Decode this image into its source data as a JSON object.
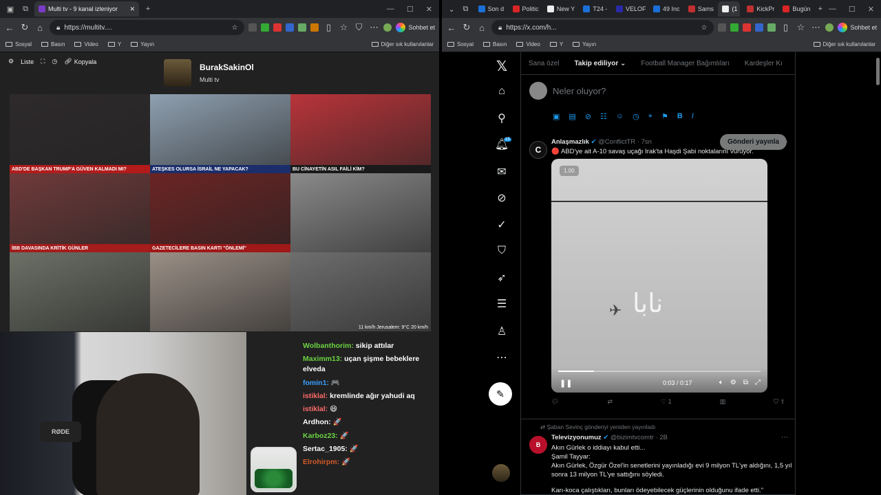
{
  "left_browser": {
    "tabs": [
      {
        "title": "Multi tv - 9 kanal izleniyor",
        "color": "#7a3cc8"
      }
    ],
    "url": "https://multitv....",
    "chat_label": "Sohbet et",
    "bookmarks": [
      "Sosyal",
      "Basın",
      "Video",
      "Y",
      "Yayın"
    ],
    "other_bookmarks": "Diğer sık kullanılanlar"
  },
  "multitv": {
    "controls": [
      "Liste",
      "Kopyala"
    ],
    "channel_name": "BurakSakinOl",
    "channel_sub": "Multi tv",
    "cells": [
      {
        "caption": "ABD'DE BAŞKAN TRUMP'A GÜVEN KALMADI MI?",
        "bg": "#2e2a2c",
        "cap": "#b31b1b"
      },
      {
        "caption": "ATEŞKES OLURSA İSRAİL NE YAPACAK?",
        "bg": "#8fa0b0",
        "cap": "#1b2e6b"
      },
      {
        "caption": "BU CİNAYETİN ASIL FAİLİ KİM?",
        "bg": "#b8343a",
        "cap": "#1a1a1a"
      },
      {
        "caption": "İBB DAVASINDA KRİTİK GÜNLER",
        "bg": "#6f3a3a",
        "cap": "#a51c1c"
      },
      {
        "caption": "GAZETECİLERE BASIN KARTI \"ÖNLEMİ\"",
        "bg": "#6b2424",
        "cap": "#a01818"
      },
      {
        "caption": "",
        "bg": "#8a8a8a",
        "cap": "transparent"
      },
      {
        "caption": "",
        "bg": "#6c7066",
        "cap": "transparent"
      },
      {
        "caption": "",
        "bg": "#9a8f86",
        "cap": "transparent"
      },
      {
        "caption": "11 km/h  Jerusalem: 9°C  20 km/h",
        "bg": "#6e6e6e",
        "cap": "transparent"
      }
    ]
  },
  "chat": [
    {
      "user": "Wolbanthorim:",
      "text": " sikip attılar",
      "color": "#6cd442"
    },
    {
      "user": "Maximm13:",
      "text": " uçan şişme bebeklere elveda",
      "color": "#6cd442"
    },
    {
      "user": "fomin1:",
      "text": " 🎮",
      "color": "#3aa0ff"
    },
    {
      "user": "istiklal:",
      "text": " kremlinde ağır yahudi aq",
      "color": "#ff6a6a"
    },
    {
      "user": "istiklal:",
      "text": " 😄",
      "color": "#ff6a6a"
    },
    {
      "user": "Ardhon:",
      "text": " 🚀",
      "color": "#ffffff"
    },
    {
      "user": "Karboz23:",
      "text": " 🚀",
      "color": "#6cd442"
    },
    {
      "user": "Sertac_1905:",
      "text": " 🚀",
      "color": "#ffffff"
    },
    {
      "user": "Elrohirpm:",
      "text": " 🚀",
      "color": "#d45a2a"
    }
  ],
  "right_browser": {
    "tabs": [
      {
        "title": "Son d",
        "color": "#1a6fd8"
      },
      {
        "title": "Politic",
        "color": "#d92525"
      },
      {
        "title": "New Y",
        "color": "#eee"
      },
      {
        "title": "T24 -",
        "color": "#1a6fd8"
      },
      {
        "title": "VELOF",
        "color": "#2a2aa8"
      },
      {
        "title": "49 Inc",
        "color": "#1a6fd8"
      },
      {
        "title": "Sams",
        "color": "#c03030"
      },
      {
        "title": "(1",
        "color": "#eee"
      },
      {
        "title": "KickPr",
        "color": "#c03030"
      },
      {
        "title": "Bugün",
        "color": "#d92525"
      }
    ],
    "url": "https://x.com/h...",
    "chat_label": "Sohbet et",
    "bookmarks": [
      "Sosyal",
      "Basın",
      "Video",
      "Y",
      "Yayın"
    ],
    "other_bookmarks": "Diğer sık kullanılanlar"
  },
  "x": {
    "tabs": [
      "Sana özel",
      "Takip ediliyor",
      "Football Manager Bağımlıları",
      "Kardeşler Kı"
    ],
    "notification_count": "15",
    "compose_placeholder": "Neler oluyor?",
    "post_button": "Gönderi yayınla",
    "tweet1": {
      "name": "Anlaşmazlık",
      "handle": "@ConflictTR",
      "time": "· 7sn",
      "text": "🔴 ABD'ye ait A-10 savaş uçağı Irak'ta Haşdi Şabi noktalarını vuruyor.",
      "speed": "1.00",
      "video_time": "0:03 / 0:17",
      "video_progress": 0.176,
      "likes": "1"
    },
    "tweet2": {
      "repost_by": "Şaban Sevinç gönderiyi yeniden yayınladı",
      "name": "Televizyonumuz",
      "handle": "@bizimtvcomtr",
      "time": "· 2B",
      "lines": [
        "Akın Gürlek o iddiayı kabul etti...",
        "Şamil Tayyar:",
        "Akın Gürlek, Özgür Özel'in senetlerini yayınladığı evi 9 milyon TL'ye aldığını, 1,5 yıl sonra 13 milyon TL'ye sattığını söyledi.",
        "",
        "Karı-koca çalıştıkları, bunları ödeyebilecek güçlerinin olduğunu ifade etti.\""
      ]
    }
  }
}
